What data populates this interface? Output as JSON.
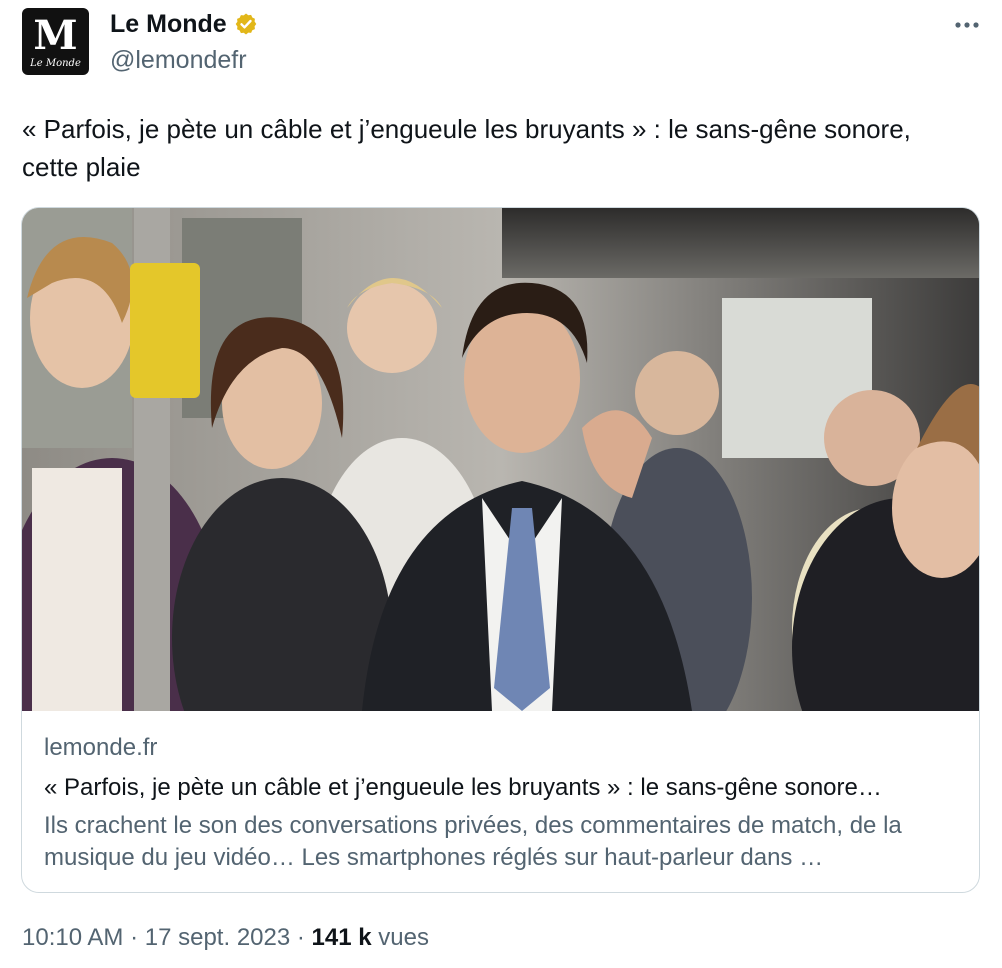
{
  "account": {
    "display_name": "Le Monde",
    "handle": "@lemondefr",
    "verified": true,
    "badge_color": "#e2b719",
    "avatar_letter": "M",
    "avatar_caption": "Le Monde"
  },
  "tweet": {
    "text": "« Parfois, je pète un câble et j’engueule les bruyants » : le sans-gêne sonore, cette plaie"
  },
  "card": {
    "image_icon": "photo-commuters-on-bus",
    "domain": "lemonde.fr",
    "title": "« Parfois, je pète un câble et j’engueule les bruyants » : le sans-gêne sonore…",
    "description": "Ils crachent le son des conversations privées, des commentaires de match, de la musique du jeu vidéo… Les smartphones réglés sur haut-parleur dans …"
  },
  "meta": {
    "time": "10:10 AM",
    "separator": "·",
    "date": "17 sept. 2023",
    "views_count": "141 k",
    "views_label": "vues"
  },
  "colors": {
    "text": "#0f1419",
    "secondary": "#536471",
    "border": "#cfd9de"
  }
}
